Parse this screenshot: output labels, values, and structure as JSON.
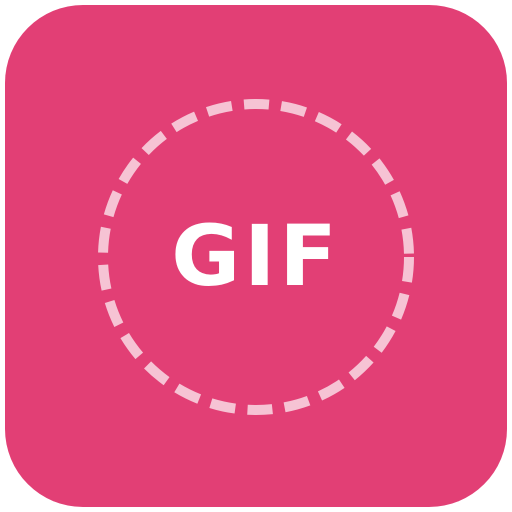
{
  "app_icon": {
    "label": "GIF",
    "icon_name": "gif-app-icon",
    "colors": {
      "background": "#E23F75",
      "dashed_ring": "#F6C3D4",
      "label": "#FFFFFF"
    }
  }
}
